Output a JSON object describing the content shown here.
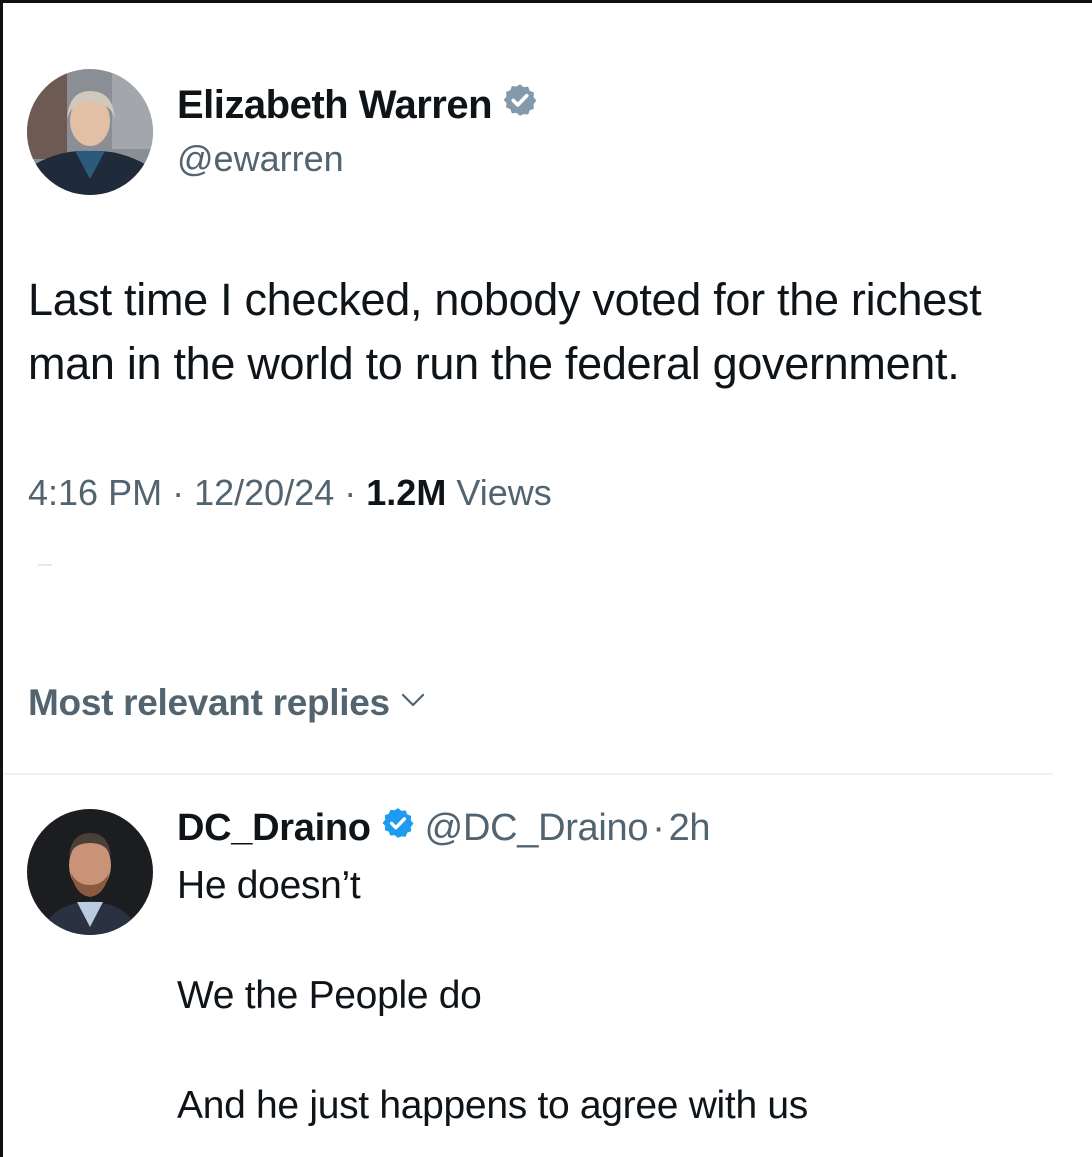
{
  "main_tweet": {
    "author_name": "Elizabeth Warren",
    "handle": "@ewarren",
    "verified_badge": "gray-check-badge",
    "text_lines": [
      "Last time I checked, nobody voted for the richest",
      "man in the world to run the federal government."
    ],
    "time": "4:16 PM",
    "separator": "·",
    "date": "12/20/24",
    "views_count": "1.2M",
    "views_label": "Views"
  },
  "replies_sort": {
    "label": "Most relevant replies",
    "icon": "chevron-down-icon"
  },
  "reply": {
    "author_name": "DC_Draino",
    "handle": "@DC_Draino",
    "separator": "·",
    "time": "2h",
    "verified_badge": "blue-check-badge",
    "lines": [
      "He doesn’t",
      "We the People do",
      "And he just happens to agree with us"
    ]
  },
  "colors": {
    "text_primary": "#0f1419",
    "text_secondary": "#536471",
    "verified_gray": "#829aab",
    "verified_blue": "#1d9bf0",
    "divider": "#eff3f4"
  }
}
